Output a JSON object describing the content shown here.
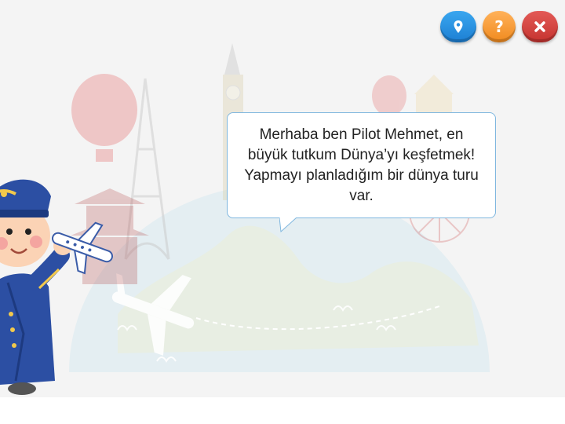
{
  "toolbar": {
    "map_button": {
      "icon": "map-pin-icon",
      "color": "#2a8fe0"
    },
    "help_button": {
      "label": "?",
      "icon": "question-icon",
      "color": "#f7a13a"
    },
    "close_button": {
      "icon": "close-icon",
      "color": "#d24340"
    }
  },
  "speech_bubble": {
    "text": "Merhaba ben Pilot Mehmet, en büyük tutkum Dünya’yı keşfetmek! Yapmayı planladığım bir dünya turu var."
  },
  "scene": {
    "background": "faded-travel-landmarks-illustration",
    "character": "pilot-character",
    "colors": {
      "bubble_border": "#7fb7df",
      "scene_bg": "#f4f4f4"
    }
  }
}
